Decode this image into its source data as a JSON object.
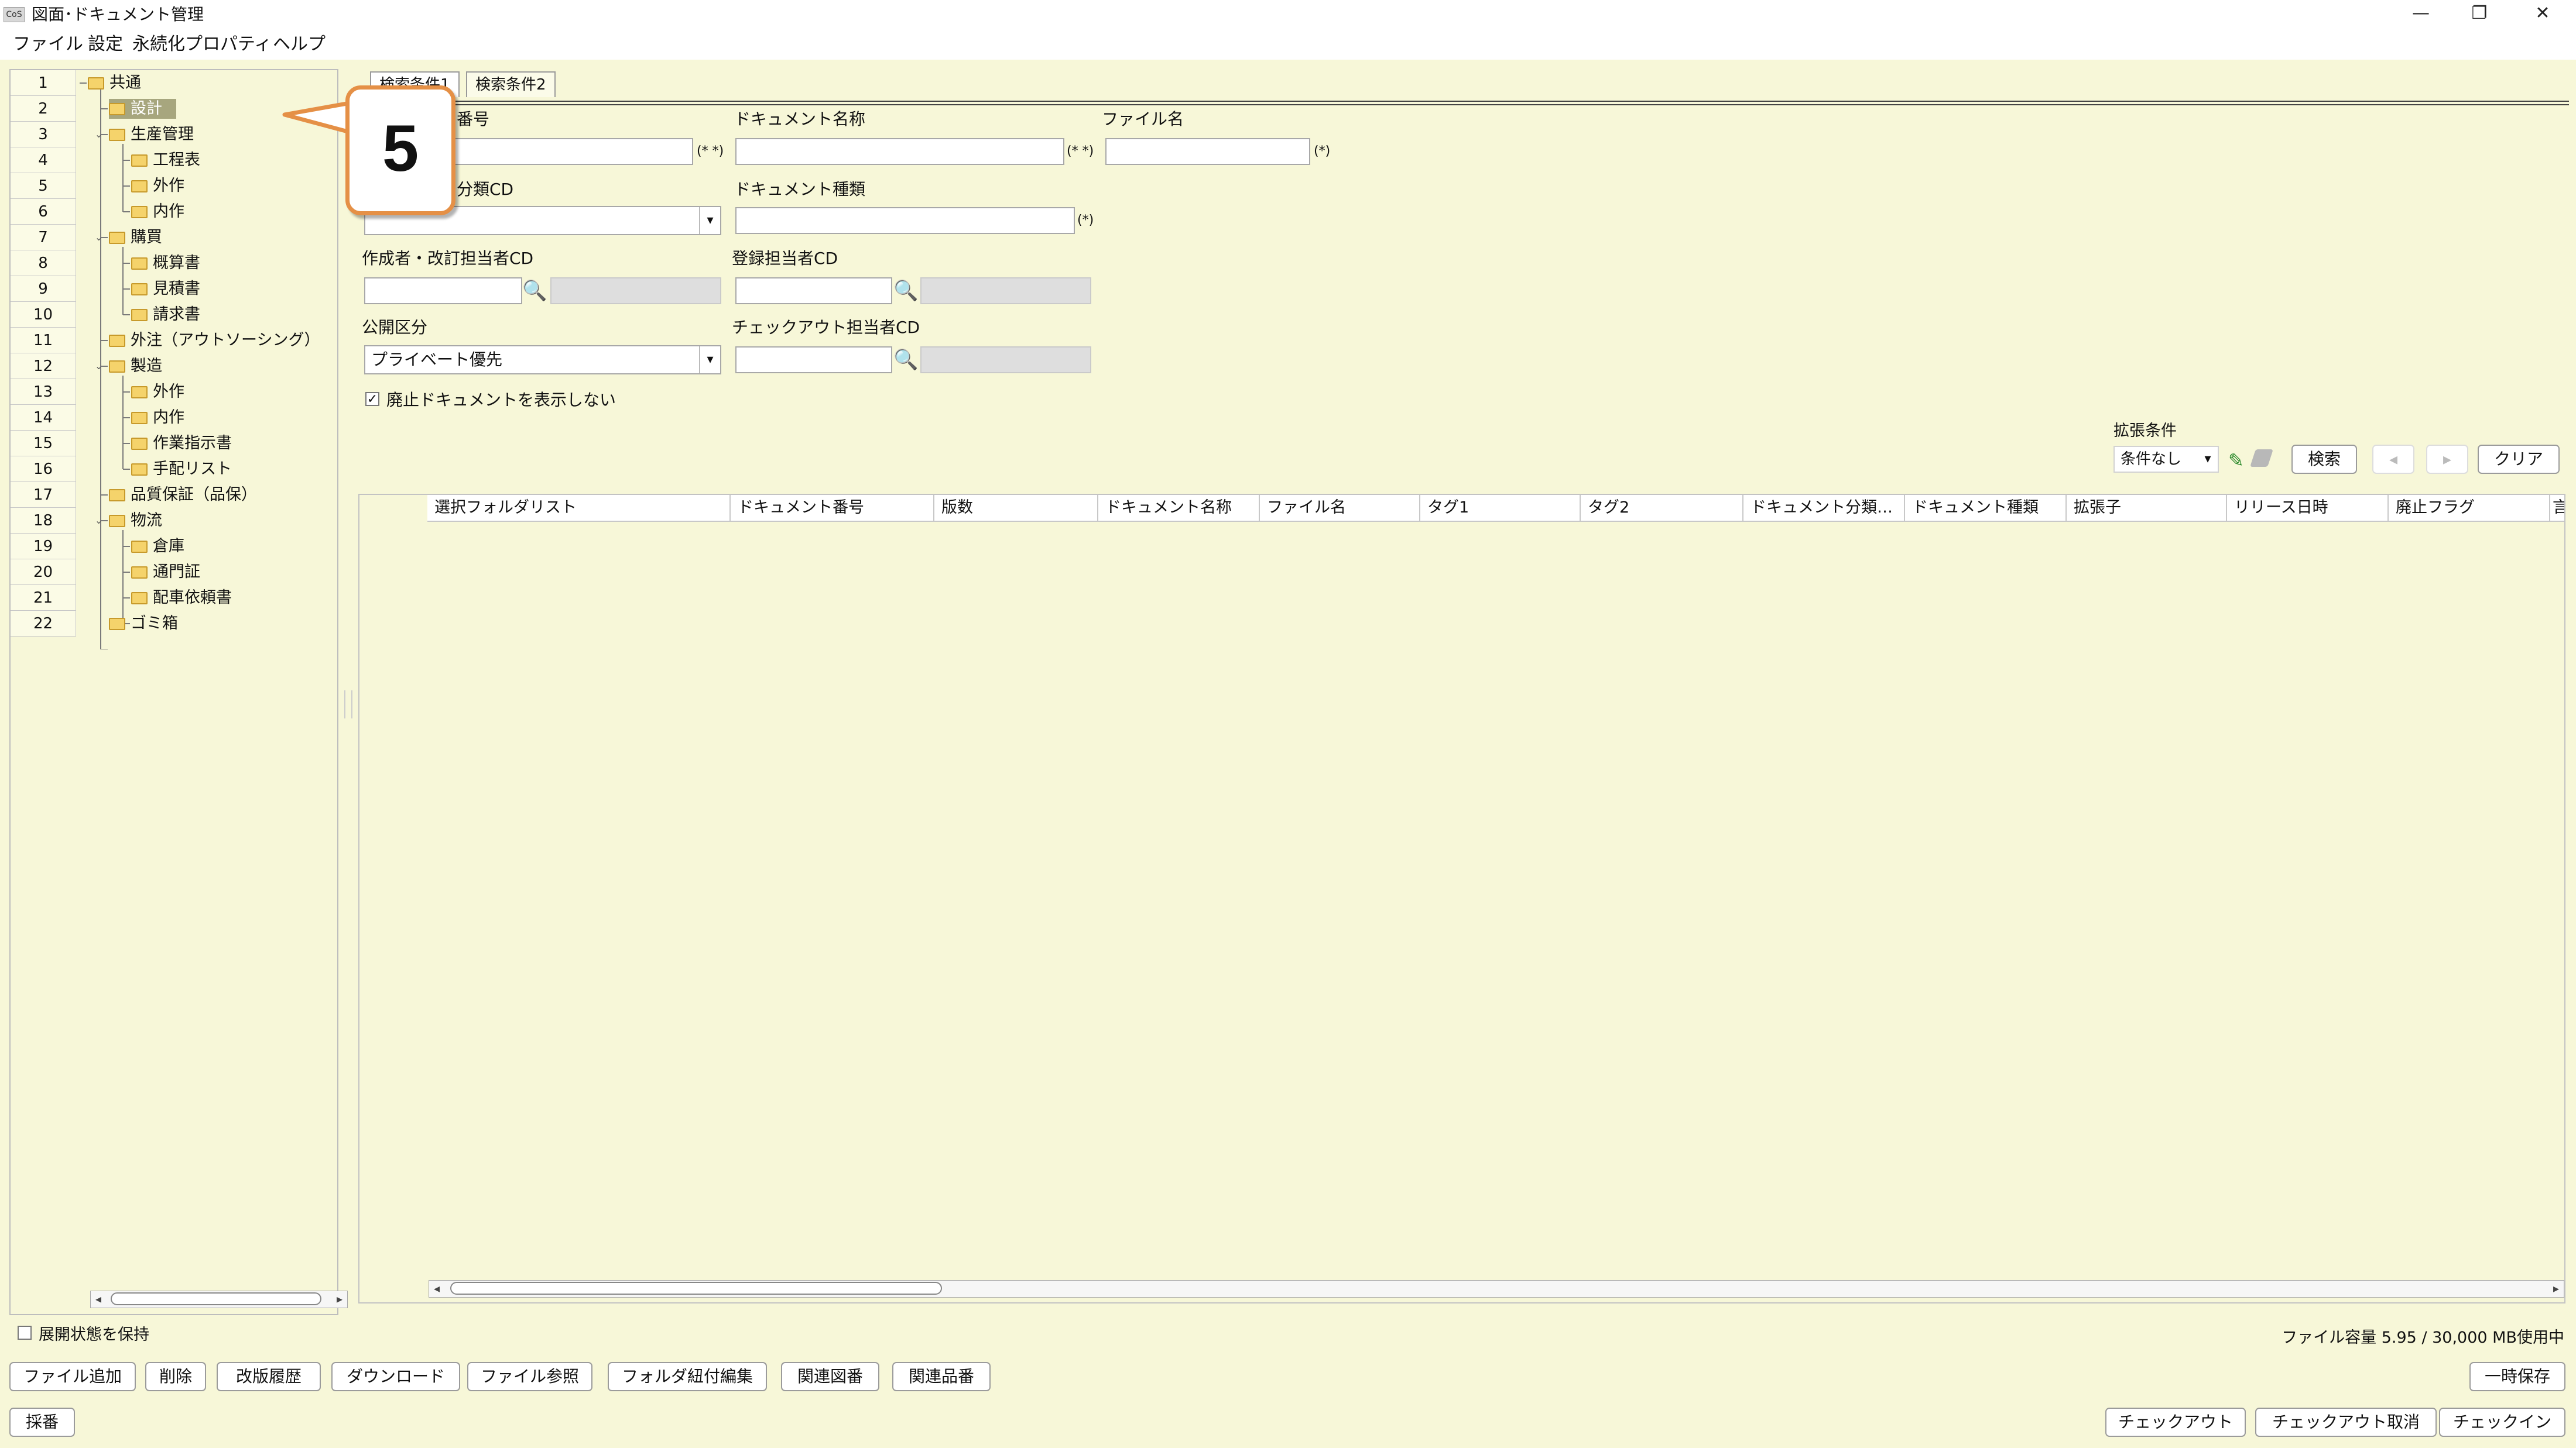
{
  "window": {
    "title": "図面･ドキュメント管理",
    "icon_text": "CoS",
    "minimize": "—",
    "restore": "❐",
    "close": "✕"
  },
  "menu": [
    "ファイル",
    "設定",
    "永続化プロパティ",
    "ヘルプ"
  ],
  "tree": {
    "rows": [
      {
        "no": "1",
        "label": "共通"
      },
      {
        "no": "2",
        "label": "設計"
      },
      {
        "no": "3",
        "label": "生産管理"
      },
      {
        "no": "4",
        "label": "工程表"
      },
      {
        "no": "5",
        "label": "外作"
      },
      {
        "no": "6",
        "label": "内作"
      },
      {
        "no": "7",
        "label": "購買"
      },
      {
        "no": "8",
        "label": "概算書"
      },
      {
        "no": "9",
        "label": "見積書"
      },
      {
        "no": "10",
        "label": "請求書"
      },
      {
        "no": "11",
        "label": "外注（アウトソーシング）"
      },
      {
        "no": "12",
        "label": "製造"
      },
      {
        "no": "13",
        "label": "外作"
      },
      {
        "no": "14",
        "label": "内作"
      },
      {
        "no": "15",
        "label": "作業指示書"
      },
      {
        "no": "16",
        "label": "手配リスト"
      },
      {
        "no": "17",
        "label": "品質保証（品保）"
      },
      {
        "no": "18",
        "label": "物流"
      },
      {
        "no": "19",
        "label": "倉庫"
      },
      {
        "no": "20",
        "label": "通門証"
      },
      {
        "no": "21",
        "label": "配車依頼書"
      },
      {
        "no": "22",
        "label": "ゴミ箱"
      }
    ],
    "keep_expand_label": "展開状態を保持"
  },
  "tabs": [
    "検索条件1",
    "検索条件2"
  ],
  "form": {
    "doc_number_label": "番号",
    "doc_name_label": "ドキュメント名称",
    "file_name_label": "ファイル名",
    "category_cd_label": "分類CD",
    "doc_type_label": "ドキュメント種類",
    "author_cd_label": "作成者・改訂担当者CD",
    "registrar_cd_label": "登録担当者CD",
    "visibility_label": "公開区分",
    "visibility_value": "プライベート優先",
    "checkout_cd_label": "チェックアウト担当者CD",
    "hide_obsolete_label": "廃止ドキュメントを表示しない",
    "hide_obsolete_checked": true,
    "req_double": "(* *)",
    "req_single": "(*)"
  },
  "extended": {
    "label": "拡張条件",
    "value": "条件なし",
    "search": "検索",
    "prev": "◂",
    "next": "▸",
    "clear": "クリア"
  },
  "grid": {
    "columns": [
      "選択フォルダリスト",
      "ドキュメント番号",
      "版数",
      "ドキュメント名称",
      "ファイル名",
      "タグ1",
      "タグ2",
      "ドキュメント分類…",
      "ドキュメント種類",
      "拡張子",
      "リリース日時",
      "廃止フラグ",
      "言"
    ]
  },
  "status": {
    "capacity": "ファイル容量 5.95 / 30,000 MB使用中"
  },
  "bottom_buttons": [
    "ファイル追加",
    "削除",
    "改版履歴",
    "ダウンロード",
    "ファイル参照",
    "フォルダ紐付編集",
    "関連図番",
    "関連品番"
  ],
  "right_buttons": {
    "temp_save": "一時保存",
    "checkout": "チェックアウト",
    "checkout_cancel": "チェックアウト取消",
    "checkin": "チェックイン"
  },
  "numbering_button": "採番",
  "callout": {
    "text": "5"
  },
  "colors": {
    "background": "#f7f7d8",
    "selection": "#a7a67e",
    "callout_border": "#e59046",
    "folder": "#f5d36b"
  }
}
